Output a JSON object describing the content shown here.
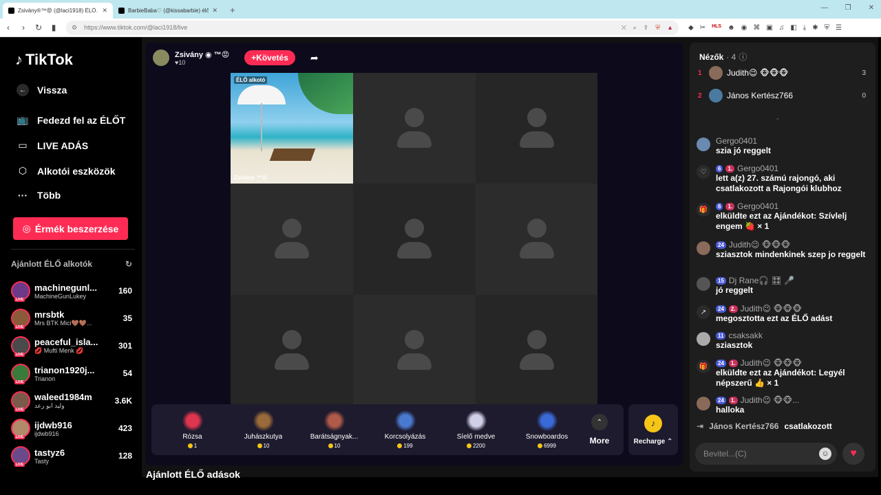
{
  "browser": {
    "tabs": [
      {
        "title": "Zsivány®™😡 (@laci1918) ÉLŐ…"
      },
      {
        "title": "BarbieBaba♡ (@kissabarbie) élő…"
      }
    ],
    "url": "https://www.tiktok.com/@laci1918/live"
  },
  "sidebar": {
    "logo": "TikTok",
    "items": [
      {
        "label": "Vissza",
        "icon": "back-arrow-icon"
      },
      {
        "label": "Fedezd fel az ÉLŐT",
        "icon": "tv-icon"
      },
      {
        "label": "LIVE ADÁS",
        "icon": "camera-icon"
      },
      {
        "label": "Alkotói eszközök",
        "icon": "lightbulb-icon"
      },
      {
        "label": "Több",
        "icon": "more-dots-icon"
      }
    ],
    "coins_button": "Érmék beszerzése",
    "recommended_heading": "Ajánlott ÉLŐ alkotók",
    "live_tag": "LIVE",
    "creators": [
      {
        "name": "machinegunl...",
        "sub": "MachineGunLukey",
        "count": "160",
        "color": "#6d3a8a"
      },
      {
        "name": "mrsbtk",
        "sub": "Mrs BTK Mici🤎🤎...",
        "count": "35",
        "color": "#8a5a3a"
      },
      {
        "name": "peaceful_isla...",
        "sub": "💋 Mufti Menk 💋",
        "count": "301",
        "color": "#4a4a4a"
      },
      {
        "name": "trianon1920j...",
        "sub": "Trianon",
        "count": "54",
        "color": "#3a7a3a"
      },
      {
        "name": "waleed1984m",
        "sub": "وليد ابو رعد",
        "count": "3.6K",
        "color": "#7a5a4a"
      },
      {
        "name": "ijdwb916",
        "sub": "ijdwb916",
        "count": "423",
        "color": "#b08a6a"
      },
      {
        "name": "tastyz6",
        "sub": "Tasty",
        "count": "128",
        "color": "#6a4a8a"
      }
    ]
  },
  "host": {
    "name": "Zsivány",
    "suffix": "™😡",
    "likes": "10",
    "follow_label": "+Követés"
  },
  "stream": {
    "live_tag": "ÉLŐ alkotó",
    "host_label": "Zsivány ™😡"
  },
  "gifts": [
    {
      "name": "Rózsa",
      "price": "1",
      "color": "#e0354f"
    },
    {
      "name": "Juhászkutya",
      "price": "10",
      "color": "#9a6a3a"
    },
    {
      "name": "Barátságnyak...",
      "price": "10",
      "color": "#b05a4a"
    },
    {
      "name": "Korcsolyázás",
      "price": "199",
      "color": "#4a7ad0"
    },
    {
      "name": "Síelő medve",
      "price": "2200",
      "color": "#d0d0e8"
    },
    {
      "name": "Snowboardos",
      "price": "6999",
      "color": "#3a6ad8"
    }
  ],
  "gift_more": "More",
  "recharge": "Recharge",
  "recommended_streams": "Ajánlott ÉLŐ adások",
  "chat": {
    "viewers_label": "Nézők",
    "viewers_count": "· 4",
    "viewers": [
      {
        "rank": "1",
        "name": "Judith😉 🐵🐵🐵",
        "score": "3",
        "color": "#8a6a5a"
      },
      {
        "rank": "2",
        "name": "János Kertész766",
        "score": "0",
        "color": "#4a7aa0"
      }
    ],
    "messages": [
      {
        "user": "Gergo0401",
        "badges": [],
        "text": "szia jó reggelt",
        "color": "#6a8ab0"
      },
      {
        "user": "Gergo0401",
        "badges": [
          "6",
          "1."
        ],
        "text": "lett a(z) 27. számú rajongó, aki csatlakozott a Rajongói klubhoz",
        "icon": "♡"
      },
      {
        "user": "Gergo0401",
        "badges": [
          "6",
          "1."
        ],
        "text": "elküldte ezt az Ajándékot: Szívlelj engem 🍓 × 1",
        "icon": "🎁"
      },
      {
        "user": "Judith😉 🐵🐵🐵",
        "badges": [
          "24"
        ],
        "text": "sziasztok mindenkinek szep jo reggelt",
        "color": "#8a6a5a"
      },
      {
        "user": "Dj Rane🎧 🎛 🎤",
        "badges": [
          "15"
        ],
        "text": "jó reggelt",
        "color": "#555"
      },
      {
        "user": "Judith😉 🐵🐵🐵",
        "badges": [
          "24",
          "2."
        ],
        "text": "megosztotta ezt az ÉLŐ adást",
        "icon": "↗"
      },
      {
        "user": "csaksakk",
        "badges": [
          "11"
        ],
        "text": "sziasztok",
        "color": "#aaa"
      },
      {
        "user": "Judith😉 🐵🐵🐵",
        "badges": [
          "24",
          "1."
        ],
        "text": "elküldte ezt az Ajándékot: Legyél népszerű 👍 × 1",
        "icon": "🎁"
      },
      {
        "user": "Judith😉 🐵🐵...",
        "badges": [
          "24",
          "1."
        ],
        "text": "halloka",
        "color": "#8a6a5a"
      }
    ],
    "join_user": "János Kertész766",
    "join_text": "csatlakozott",
    "input_placeholder": "Bevitel...(C)"
  }
}
